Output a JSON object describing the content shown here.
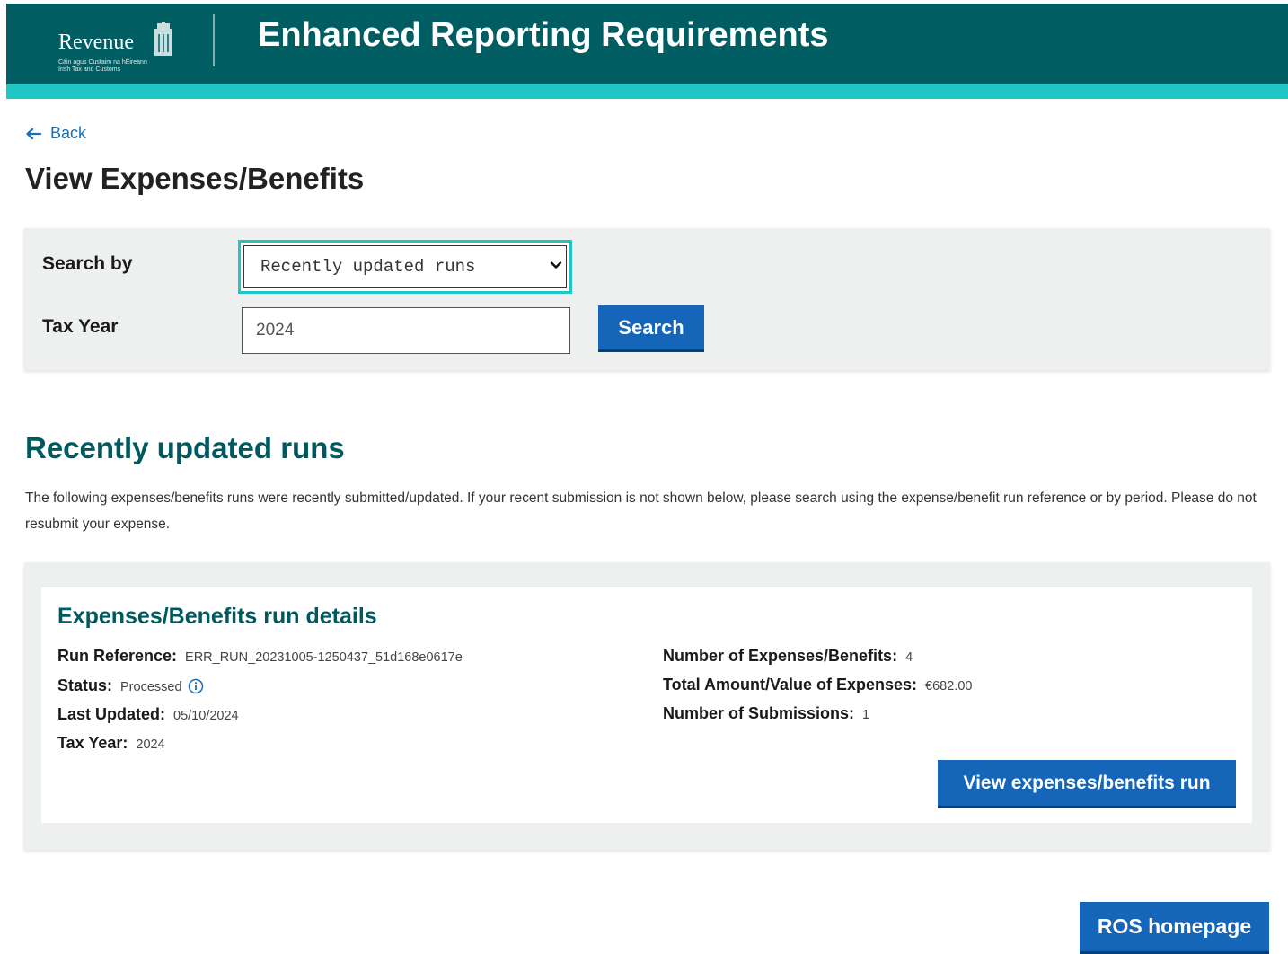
{
  "header": {
    "logo_word": "Revenue",
    "logo_sub_1": "Cáin agus Custaim na hÉireann",
    "logo_sub_2": "Irish Tax and Customs",
    "title": "Enhanced Reporting Requirements"
  },
  "nav": {
    "back_label": "Back"
  },
  "page_title": "View Expenses/Benefits",
  "search": {
    "search_by_label": "Search by",
    "search_by_value": "Recently updated runs",
    "tax_year_label": "Tax Year",
    "tax_year_value": "2024",
    "search_button": "Search"
  },
  "recent": {
    "title": "Recently updated runs",
    "description": "The following expenses/benefits runs were recently submitted/updated. If your recent submission is not shown below, please search using the expense/benefit run reference or by period. Please do not resubmit your expense."
  },
  "run": {
    "title": "Expenses/Benefits run details",
    "run_reference_label": "Run Reference:",
    "run_reference_value": "ERR_RUN_20231005-1250437_51d168e0617e",
    "status_label": "Status:",
    "status_value": "Processed",
    "last_updated_label": "Last Updated:",
    "last_updated_value": "05/10/2024",
    "tax_year_label": "Tax Year:",
    "tax_year_value": "2024",
    "num_expenses_label": "Number of Expenses/Benefits:",
    "num_expenses_value": "4",
    "total_amount_label": "Total Amount/Value of Expenses:",
    "total_amount_value": "€682.00",
    "num_submissions_label": "Number of Submissions:",
    "num_submissions_value": "1",
    "view_button": "View expenses/benefits run"
  },
  "footer": {
    "ros_button": "ROS homepage"
  },
  "colors": {
    "header_bg": "#005e63",
    "header_stripe": "#1ec6c6",
    "primary_button": "#1565b8",
    "heading_teal": "#00595e",
    "link_blue": "#1a6fb5"
  }
}
